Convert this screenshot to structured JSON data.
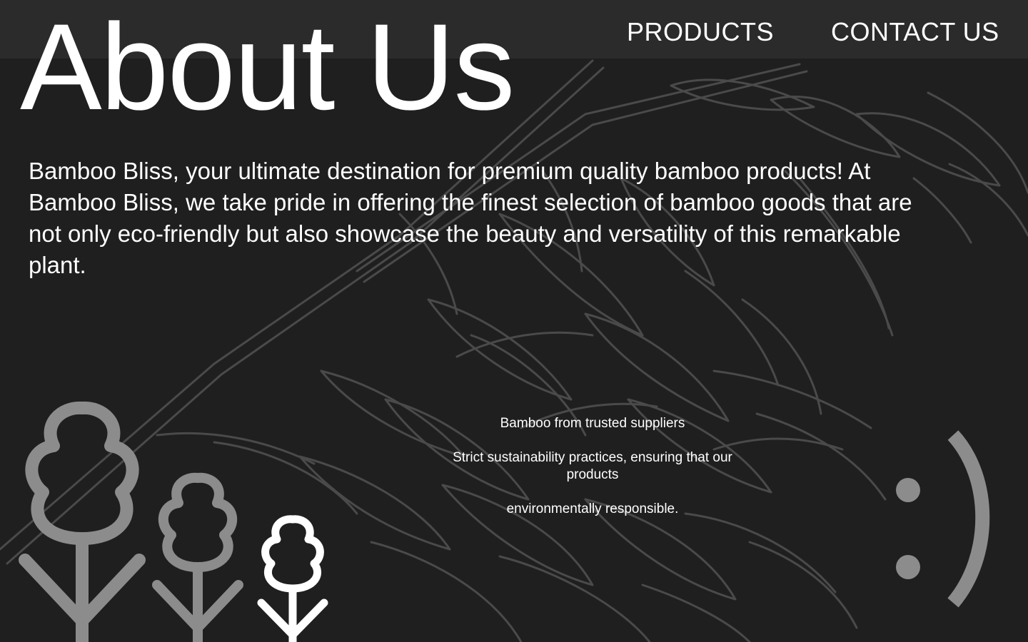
{
  "nav": {
    "products_label": "PRODUCTS",
    "contact_label": "CONTACT US"
  },
  "hero": {
    "title": "About Us"
  },
  "intro": {
    "text": "Bamboo Bliss, your ultimate destination for premium quality bamboo products! At Bamboo Bliss, we take pride in offering the finest selection of bamboo goods that are not only eco-friendly but also showcase the beauty and versatility of this remarkable plant."
  },
  "features": [
    "Bamboo from trusted suppliers",
    "Strict sustainability practices, ensuring that our products",
    "environmentally responsible."
  ],
  "decor": {
    "background": "bamboo-leaves-line-art",
    "trees": "tree-icons",
    "smiley": "smiley-emoticon"
  },
  "colors": {
    "background": "#1f1f1f",
    "nav_bar": "#2b2b2b",
    "text": "#ffffff",
    "line_art": "#4a4a4a",
    "muted_icon": "#8c8c8c"
  }
}
